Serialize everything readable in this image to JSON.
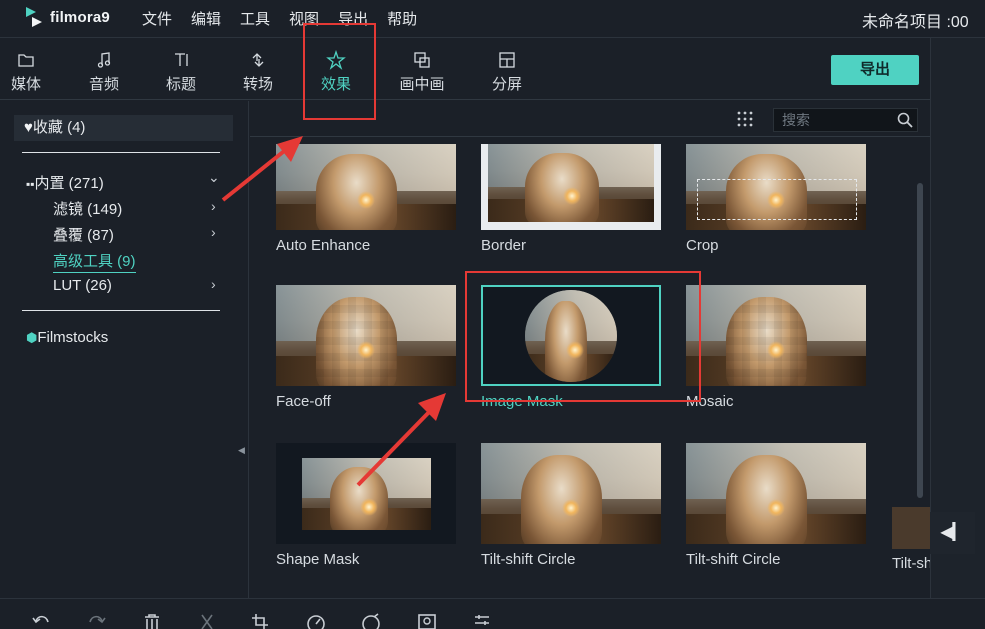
{
  "app": {
    "name": "filmora9",
    "project_title": "未命名项目 :00"
  },
  "menu": [
    "文件",
    "编辑",
    "工具",
    "视图",
    "导出",
    "帮助"
  ],
  "toolbar": {
    "tabs": [
      {
        "label": "媒体",
        "icon": "folder-icon"
      },
      {
        "label": "音频",
        "icon": "music-note-icon"
      },
      {
        "label": "标题",
        "icon": "title-text-icon"
      },
      {
        "label": "转场",
        "icon": "transition-icon"
      },
      {
        "label": "效果",
        "icon": "effects-icon",
        "active": true
      },
      {
        "label": "画中画",
        "icon": "picture-in-picture-icon"
      },
      {
        "label": "分屏",
        "icon": "split-screen-icon"
      }
    ],
    "export_label": "导出"
  },
  "sidebar": {
    "favorites": "收藏 (4)",
    "builtin": "内置 (271)",
    "items": [
      {
        "label": "滤镜 (149)",
        "chevron": true
      },
      {
        "label": "叠覆 (87)",
        "chevron": true
      },
      {
        "label": "高级工具 (9)",
        "selected": true
      },
      {
        "label": "LUT (26)",
        "chevron": true
      }
    ],
    "filmstocks": "Filmstocks"
  },
  "search": {
    "placeholder": "搜索"
  },
  "effects": [
    {
      "label": "Auto Enhance"
    },
    {
      "label": "Border"
    },
    {
      "label": "Crop"
    },
    {
      "label": "Face-off"
    },
    {
      "label": "Image Mask",
      "selected": true
    },
    {
      "label": "Mosaic"
    },
    {
      "label": "Shape Mask"
    },
    {
      "label": "Tilt-shift Circle"
    },
    {
      "label": "Tilt-shift Circle"
    },
    {
      "label": "Tilt-shif"
    }
  ],
  "colors": {
    "accent": "#4fd2c2",
    "annotation": "#e53935",
    "background": "#1b2028"
  }
}
